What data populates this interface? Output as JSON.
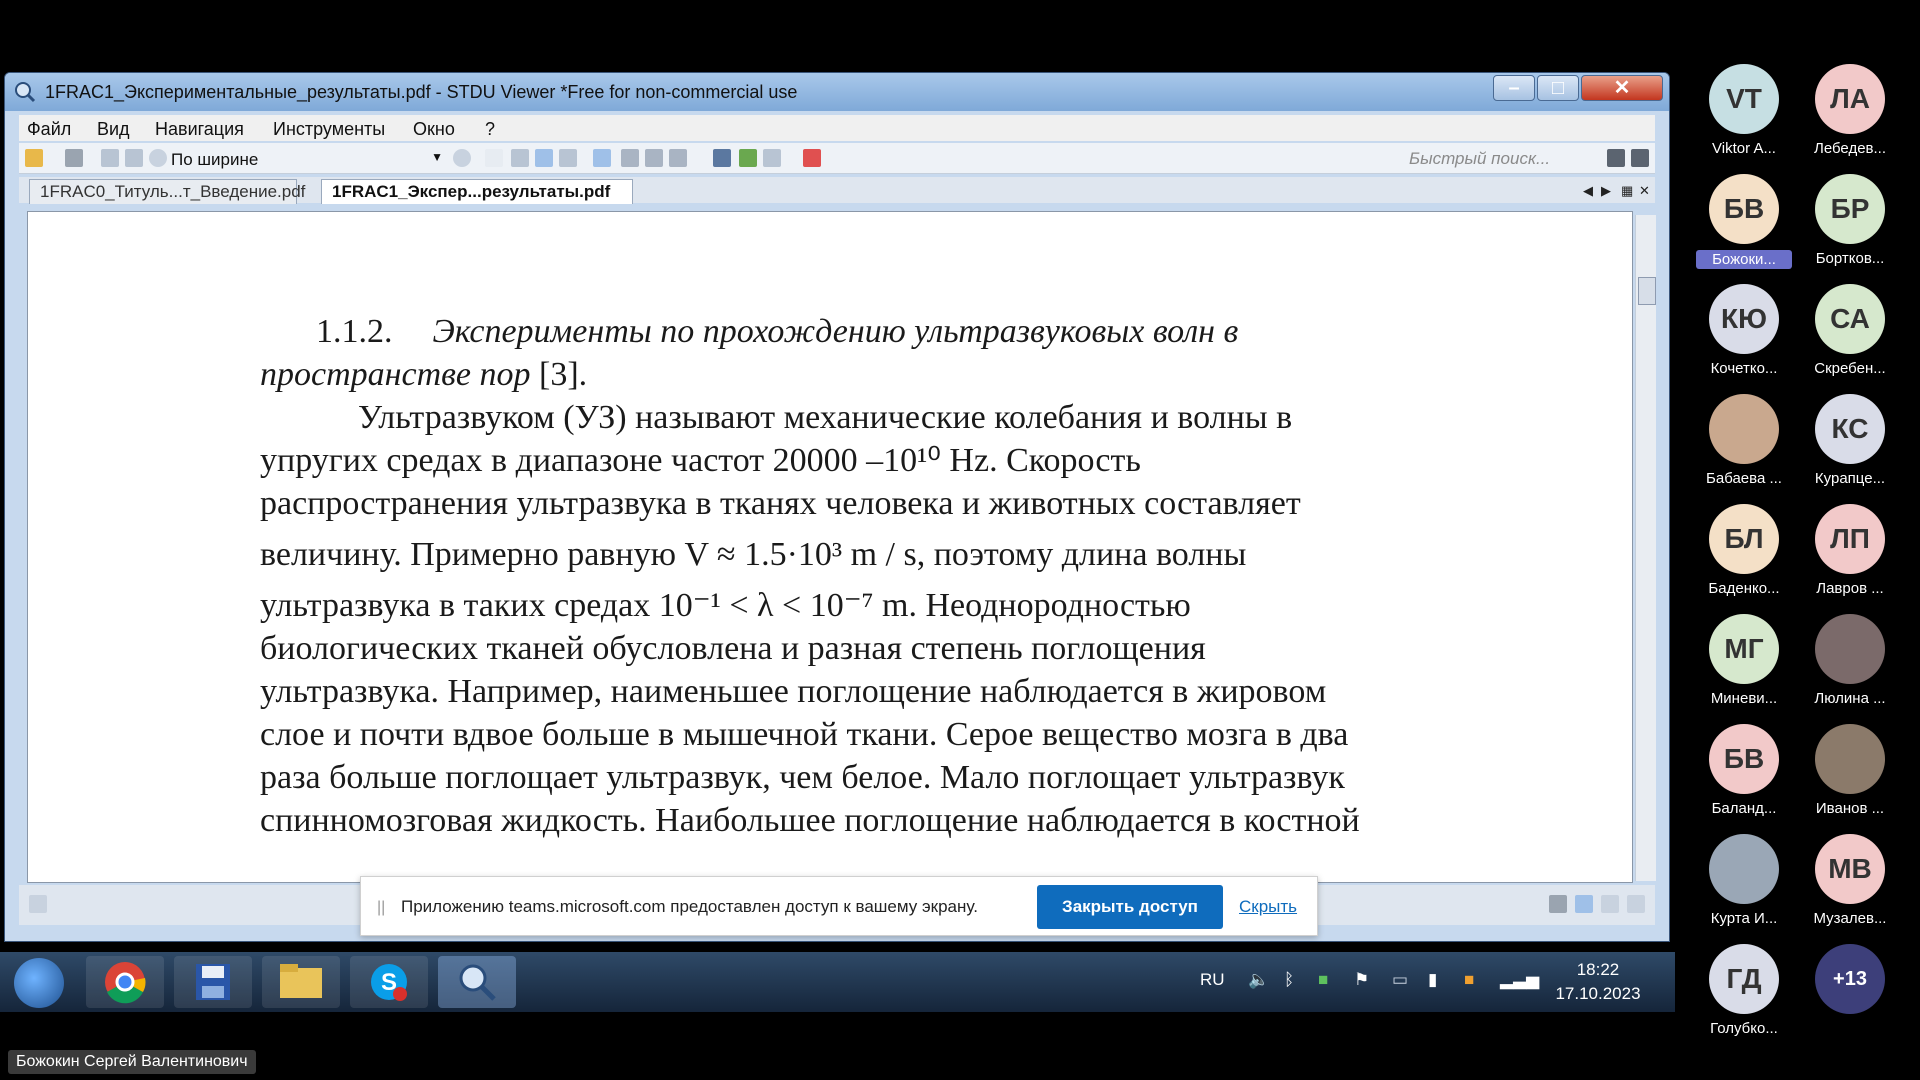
{
  "window": {
    "title": "1FRAC1_Экспериментальные_результаты.pdf - STDU Viewer *Free for non-commercial use"
  },
  "menu": {
    "file": "Файл",
    "view": "Вид",
    "navigation": "Навигация",
    "tools": "Инструменты",
    "window": "Окно",
    "help": "?"
  },
  "toolbar": {
    "zoom_label": "По ширине",
    "quick_search_placeholder": "Быстрый поиск..."
  },
  "tabs": [
    {
      "label": "1FRAC0_Титуль...т_Введение.pdf"
    },
    {
      "label": "1FRAC1_Экспер...результаты.pdf"
    }
  ],
  "document": {
    "heading_num": "1.1.2.",
    "heading_line1": "Эксперименты по прохождению ультразвуковых волн в",
    "heading_line2": "пространстве пор",
    "heading_ref": "[3].",
    "lines": [
      "Ультразвуком (УЗ) называют механические колебания и волны в",
      "упругих средах в диапазоне частот 20000 –10¹⁰ Hz. Скорость",
      "распространения ультразвука в тканях человека и животных составляет",
      "величину. Примерно равную V ≈ 1.5·10³ m / s, поэтому длина волны",
      "ультразвука в таких средах 10⁻¹ < λ < 10⁻⁷ m. Неоднородностью",
      "биологических тканей обусловлена и разная степень поглощения",
      "ультразвука. Например, наименьшее поглощение наблюдается в жировом",
      "слое и почти вдвое больше в мышечной ткани. Серое вещество мозга в два",
      "раза больше поглощает ультразвук, чем белое. Мало поглощает ультразвук",
      "спинномозговая жидкость. Наибольшее поглощение наблюдается в костной"
    ]
  },
  "notification": {
    "message": "Приложению teams.microsoft.com предоставлен доступ к вашему экрану.",
    "stop_button": "Закрыть доступ",
    "hide_link": "Скрыть"
  },
  "taskbar": {
    "lang": "RU",
    "time": "18:22",
    "date": "17.10.2023"
  },
  "participants": [
    {
      "initials": "VT",
      "name": "Viktor A...",
      "color": "#c6dfe3"
    },
    {
      "initials": "ЛА",
      "name": "Лебедев...",
      "color": "#f2c9c9"
    },
    {
      "initials": "БВ",
      "name": "Божоки...",
      "color": "#f4e0c7"
    },
    {
      "initials": "БР",
      "name": "Бортков...",
      "color": "#d6e8cd"
    },
    {
      "initials": "КЮ",
      "name": "Кочетко...",
      "color": "#d9dce8"
    },
    {
      "initials": "СА",
      "name": "Скребен...",
      "color": "#d6e8cd"
    },
    {
      "initials": "",
      "name": "Бабаева ...",
      "color": "#c9a88e"
    },
    {
      "initials": "КС",
      "name": "Курапце...",
      "color": "#d9dce8"
    },
    {
      "initials": "БЛ",
      "name": "Баденко...",
      "color": "#f4e0c7"
    },
    {
      "initials": "ЛП",
      "name": "Лавров ...",
      "color": "#f2c9c9"
    },
    {
      "initials": "МГ",
      "name": "Миневи...",
      "color": "#d6e8cd"
    },
    {
      "initials": "",
      "name": "Люлина ...",
      "color": "#7b6a6a"
    },
    {
      "initials": "БВ",
      "name": "Баланд...",
      "color": "#f2c9c9"
    },
    {
      "initials": "",
      "name": "Иванов ...",
      "color": "#8b7a6a"
    },
    {
      "initials": "",
      "name": "Курта И...",
      "color": "#9aa7b6"
    },
    {
      "initials": "МВ",
      "name": "Музалев...",
      "color": "#f2c9c9"
    },
    {
      "initials": "ГД",
      "name": "Голубко...",
      "color": "#d9dce8"
    },
    {
      "initials": "+13",
      "name": "",
      "color": "#3d3f7a"
    }
  ],
  "speaker": "Божокин Сергей Валентинович"
}
